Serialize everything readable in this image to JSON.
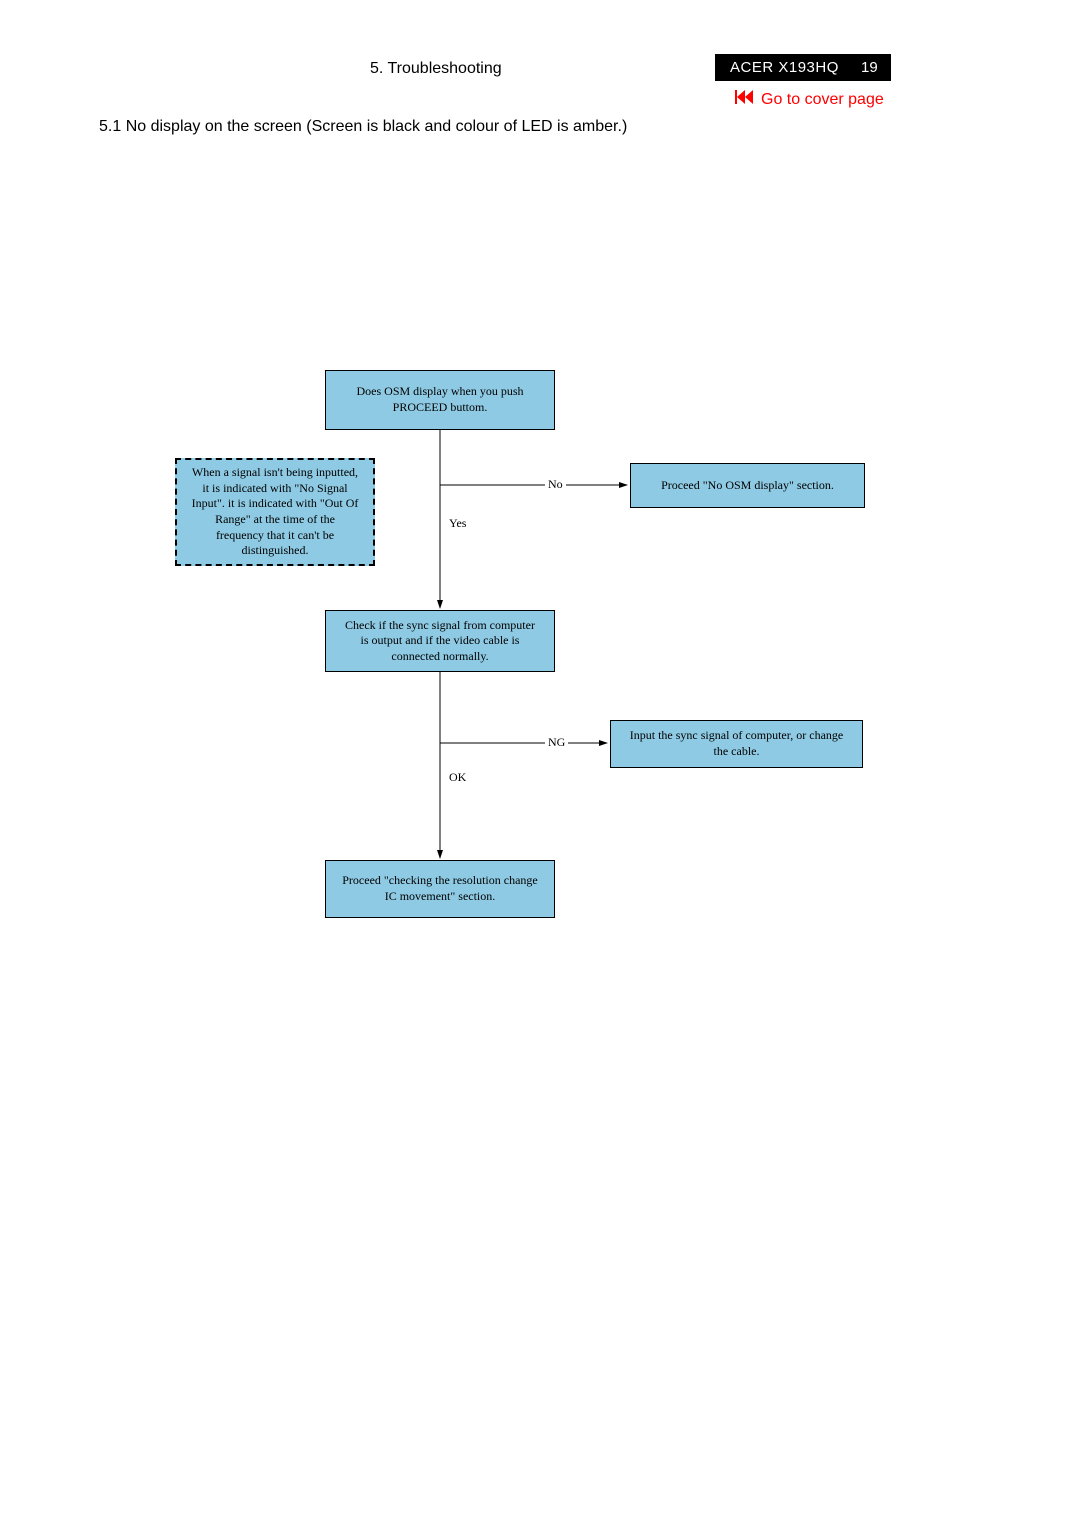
{
  "header": {
    "title": "5. Troubleshooting",
    "model": "ACER X193HQ",
    "page_number": "19",
    "cover_link": "Go to cover page"
  },
  "section": {
    "heading": "5.1 No display on the screen (Screen is black and colour of LED is amber.)"
  },
  "flow": {
    "box1": "Does OSM display when you push PROCEED buttom.",
    "note": "When a signal isn't being inputted, it is indicated with \"No Signal Input\". it is indicated with \"Out Of Range\" at the time of the frequency that it can't be distinguished.",
    "box2_right": "Proceed \"No OSM display\" section.",
    "box3": "Check if the sync signal from computer is output and if the video cable is connected normally.",
    "box4_right": "Input the sync signal of computer, or change the cable.",
    "box5": "Proceed \"checking the resolution change IC movement\" section.",
    "labels": {
      "no": "No",
      "yes": "Yes",
      "ng": "NG",
      "ok": "OK"
    }
  }
}
